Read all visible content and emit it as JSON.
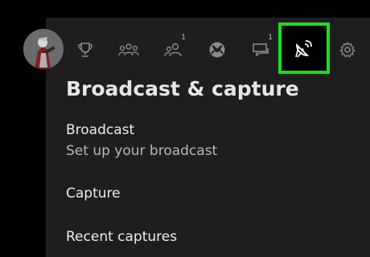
{
  "tabs": [
    {
      "name": "achievements",
      "icon": "trophy-icon",
      "badge": ""
    },
    {
      "name": "parties",
      "icon": "party-icon",
      "badge": ""
    },
    {
      "name": "friends",
      "icon": "people-icon",
      "badge": "1"
    },
    {
      "name": "home",
      "icon": "xbox-icon",
      "badge": ""
    },
    {
      "name": "messages",
      "icon": "messages-icon",
      "badge": "1"
    },
    {
      "name": "broadcast",
      "icon": "broadcast-icon",
      "badge": ""
    },
    {
      "name": "settings",
      "icon": "gear-icon",
      "badge": ""
    }
  ],
  "highlight_color": "#18e01a",
  "section": {
    "title": "Broadcast & capture",
    "items": [
      {
        "label": "Broadcast",
        "sublabel": "Set up your broadcast"
      },
      {
        "label": "Capture"
      },
      {
        "label": "Recent captures"
      }
    ]
  }
}
